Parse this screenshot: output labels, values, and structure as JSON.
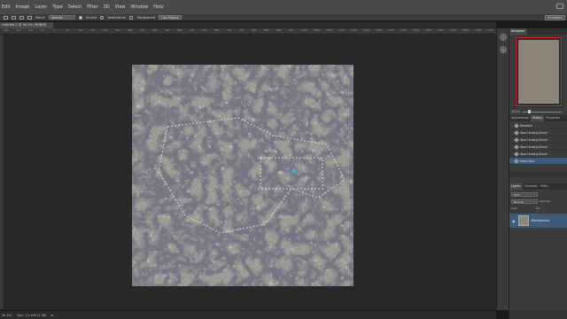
{
  "menu": [
    "Edit",
    "Image",
    "Layer",
    "Type",
    "Select",
    "Filter",
    "3D",
    "View",
    "Window",
    "Help"
  ],
  "options": {
    "patch_label": "Patch:",
    "patch_mode": "Normal",
    "source_label": "Source",
    "destination_label": "Destination",
    "transparent_label": "Transparent",
    "use_pattern_label": "Use Pattern",
    "workspace": "Essentials"
  },
  "document": {
    "tab_title": "Untitled-1 @ 34.2% (RGB/8)",
    "zoom": "34.2%",
    "doc_size": "Doc: 11.4M/11.4M",
    "ruler_ticks": [
      "200",
      "150",
      "100",
      "50",
      "0",
      "50",
      "100",
      "150",
      "200",
      "250",
      "300",
      "350",
      "400",
      "450",
      "500",
      "550",
      "600",
      "650",
      "700",
      "750",
      "800",
      "850",
      "900",
      "950",
      "1000",
      "1050",
      "1100",
      "1150",
      "1200",
      "1250",
      "1300",
      "1350",
      "1400",
      "1450",
      "1500",
      "1550",
      "1600",
      "1650",
      "1700",
      "1750"
    ]
  },
  "panels": {
    "navigator_tab": "Navigator",
    "nav_zoom": "34.2%",
    "history_tabs": [
      "Adjustments",
      "History",
      "Properties"
    ],
    "history_items": [
      "Deselect",
      "Spot Healing Brush",
      "Spot Healing Brush",
      "Spot Healing Brush",
      "Spot Healing Brush",
      "Patch Tool"
    ],
    "history_selected_index": 5,
    "layer_tabs": [
      "Layers",
      "Channels",
      "Paths"
    ],
    "layer_kind": "Kind",
    "blend_mode": "Normal",
    "opacity_label": "Opacity:",
    "lock_label": "Lock:",
    "fill_label": "Fill:",
    "layer_name": "Background"
  },
  "colors": {
    "accent_selected": "#3e5b7a",
    "nav_view_box": "#d03030"
  }
}
